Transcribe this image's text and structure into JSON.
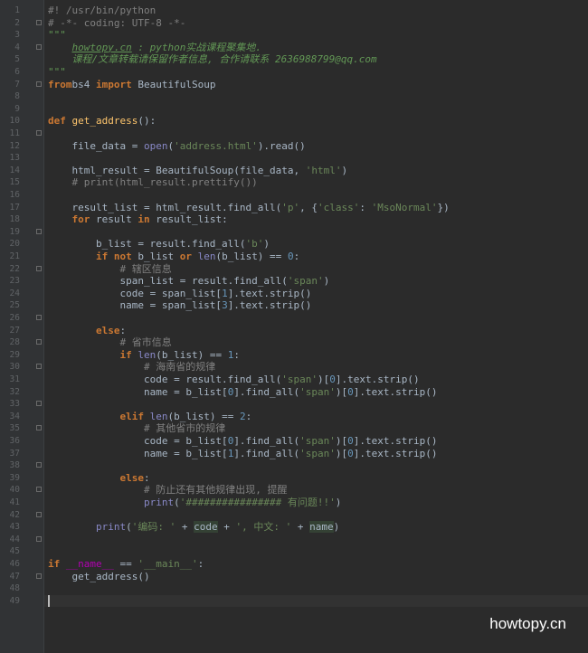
{
  "editor": {
    "lines": [
      {
        "n": "1",
        "segs": [
          [
            "cmt",
            "#! /usr/bin/python"
          ]
        ]
      },
      {
        "n": "2",
        "segs": [
          [
            "cmt",
            "# -*- coding: UTF-8 -*-"
          ]
        ]
      },
      {
        "n": "3",
        "segs": [
          [
            "doc",
            "\"\"\""
          ]
        ]
      },
      {
        "n": "4",
        "segs": [
          [
            "doc",
            "    "
          ],
          [
            "link",
            "howtopy.cn"
          ],
          [
            "doc",
            " : python实战课程聚集地."
          ]
        ]
      },
      {
        "n": "5",
        "segs": [
          [
            "doc",
            "    课程/文章转载请保留作者信息, 合作请联系 2636988799@qq.com"
          ]
        ]
      },
      {
        "n": "6",
        "segs": [
          [
            "doc",
            "\"\"\""
          ]
        ]
      },
      {
        "n": "7",
        "segs": [
          [
            "kw",
            "from"
          ],
          [
            "",
            "bs4 "
          ],
          [
            "kw",
            "import"
          ],
          [
            "",
            " BeautifulSoup"
          ]
        ]
      },
      {
        "n": "8",
        "segs": []
      },
      {
        "n": "9",
        "segs": []
      },
      {
        "n": "10",
        "segs": [
          [
            "kw",
            "def "
          ],
          [
            "fn",
            "get_address"
          ],
          [
            "",
            "():"
          ]
        ]
      },
      {
        "n": "11",
        "segs": []
      },
      {
        "n": "12",
        "segs": [
          [
            "",
            "    file_data = "
          ],
          [
            "bi",
            "open"
          ],
          [
            "",
            "("
          ],
          [
            "str",
            "'address.html'"
          ],
          [
            "",
            ").read()"
          ]
        ]
      },
      {
        "n": "13",
        "segs": []
      },
      {
        "n": "14",
        "segs": [
          [
            "",
            "    html_result = BeautifulSoup(file_data, "
          ],
          [
            "str",
            "'html'"
          ],
          [
            "",
            ")"
          ]
        ]
      },
      {
        "n": "15",
        "segs": [
          [
            "cmt",
            "    # print(html_result.prettify())"
          ]
        ]
      },
      {
        "n": "16",
        "segs": []
      },
      {
        "n": "17",
        "segs": [
          [
            "",
            "    result_list = html_result.find_all("
          ],
          [
            "str",
            "'p'"
          ],
          [
            "",
            ", {"
          ],
          [
            "str",
            "'class'"
          ],
          [
            "",
            ": "
          ],
          [
            "str",
            "'MsoNormal'"
          ],
          [
            "",
            "})"
          ]
        ]
      },
      {
        "n": "18",
        "segs": [
          [
            "kw",
            "    for "
          ],
          [
            "",
            "result "
          ],
          [
            "kw",
            "in "
          ],
          [
            "",
            "result_list:"
          ]
        ]
      },
      {
        "n": "19",
        "segs": []
      },
      {
        "n": "20",
        "segs": [
          [
            "",
            "        b_list = result.find_all("
          ],
          [
            "str",
            "'b'"
          ],
          [
            "",
            ")"
          ]
        ]
      },
      {
        "n": "21",
        "segs": [
          [
            "kw",
            "        if not "
          ],
          [
            "",
            "b_list "
          ],
          [
            "kw",
            "or "
          ],
          [
            "bi",
            "len"
          ],
          [
            "",
            "(b_list) == "
          ],
          [
            "num",
            "0"
          ],
          [
            "",
            ":"
          ]
        ]
      },
      {
        "n": "22",
        "segs": [
          [
            "cmt",
            "            # 辖区信息"
          ]
        ]
      },
      {
        "n": "23",
        "segs": [
          [
            "",
            "            span_list = result.find_all("
          ],
          [
            "str",
            "'span'"
          ],
          [
            "",
            ")"
          ]
        ]
      },
      {
        "n": "24",
        "segs": [
          [
            "",
            "            code = span_list["
          ],
          [
            "num",
            "1"
          ],
          [
            "",
            "].text.strip()"
          ]
        ]
      },
      {
        "n": "25",
        "segs": [
          [
            "",
            "            name = span_list["
          ],
          [
            "num",
            "3"
          ],
          [
            "",
            "].text.strip()"
          ]
        ]
      },
      {
        "n": "26",
        "segs": []
      },
      {
        "n": "27",
        "segs": [
          [
            "kw",
            "        else"
          ],
          [
            "",
            ":"
          ]
        ]
      },
      {
        "n": "28",
        "segs": [
          [
            "cmt",
            "            # 省市信息"
          ]
        ]
      },
      {
        "n": "29",
        "segs": [
          [
            "kw",
            "            if "
          ],
          [
            "bi",
            "len"
          ],
          [
            "",
            "(b_list) == "
          ],
          [
            "num",
            "1"
          ],
          [
            "",
            ":"
          ]
        ]
      },
      {
        "n": "30",
        "segs": [
          [
            "cmt",
            "                # 海南省的规律"
          ]
        ]
      },
      {
        "n": "31",
        "segs": [
          [
            "",
            "                code = result.find_all("
          ],
          [
            "str",
            "'span'"
          ],
          [
            "",
            ")["
          ],
          [
            "num",
            "0"
          ],
          [
            "",
            "].text.strip()"
          ]
        ]
      },
      {
        "n": "32",
        "segs": [
          [
            "",
            "                name = b_list["
          ],
          [
            "num",
            "0"
          ],
          [
            "",
            "].find_all("
          ],
          [
            "str",
            "'span'"
          ],
          [
            "",
            ")["
          ],
          [
            "num",
            "0"
          ],
          [
            "",
            "].text.strip()"
          ]
        ]
      },
      {
        "n": "33",
        "segs": []
      },
      {
        "n": "34",
        "segs": [
          [
            "kw",
            "            elif "
          ],
          [
            "bi",
            "len"
          ],
          [
            "",
            "(b_list) == "
          ],
          [
            "num",
            "2"
          ],
          [
            "",
            ":"
          ]
        ]
      },
      {
        "n": "35",
        "segs": [
          [
            "cmt",
            "                # 其他省市的规律"
          ]
        ]
      },
      {
        "n": "36",
        "segs": [
          [
            "",
            "                code = b_list["
          ],
          [
            "num",
            "0"
          ],
          [
            "",
            "].find_all("
          ],
          [
            "str",
            "'span'"
          ],
          [
            "",
            ")["
          ],
          [
            "num",
            "0"
          ],
          [
            "",
            "].text.strip()"
          ]
        ]
      },
      {
        "n": "37",
        "segs": [
          [
            "",
            "                name = b_list["
          ],
          [
            "num",
            "1"
          ],
          [
            "",
            "].find_all("
          ],
          [
            "str",
            "'span'"
          ],
          [
            "",
            ")["
          ],
          [
            "num",
            "0"
          ],
          [
            "",
            "].text.strip()"
          ]
        ]
      },
      {
        "n": "38",
        "segs": []
      },
      {
        "n": "39",
        "segs": [
          [
            "kw",
            "            else"
          ],
          [
            "",
            ":"
          ]
        ]
      },
      {
        "n": "40",
        "segs": [
          [
            "cmt",
            "                # 防止还有其他规律出现, 提醒"
          ]
        ]
      },
      {
        "n": "41",
        "segs": [
          [
            "",
            "                "
          ],
          [
            "bi",
            "print"
          ],
          [
            "",
            "("
          ],
          [
            "str",
            "'################ 有问题!!'"
          ],
          [
            "",
            ")"
          ]
        ]
      },
      {
        "n": "42",
        "segs": []
      },
      {
        "n": "43",
        "segs": [
          [
            "",
            "        "
          ],
          [
            "bi",
            "print"
          ],
          [
            "",
            "("
          ],
          [
            "str",
            "'编码: '"
          ],
          [
            "",
            " + "
          ],
          [
            "hl",
            "code"
          ],
          [
            "",
            " + "
          ],
          [
            "str",
            "', 中文: '"
          ],
          [
            "",
            " + "
          ],
          [
            "hl",
            "name"
          ],
          [
            "",
            ")"
          ]
        ]
      },
      {
        "n": "44",
        "segs": []
      },
      {
        "n": "45",
        "segs": []
      },
      {
        "n": "46",
        "segs": [
          [
            "kw",
            "if "
          ],
          [
            "mg",
            "__name__"
          ],
          [
            "",
            " == "
          ],
          [
            "str",
            "'__main__'"
          ],
          [
            "",
            ":"
          ]
        ]
      },
      {
        "n": "47",
        "segs": [
          [
            "",
            "    get_address()"
          ]
        ]
      },
      {
        "n": "48",
        "segs": []
      },
      {
        "n": "49",
        "segs": []
      }
    ],
    "folds": [
      1,
      3,
      6,
      10,
      18,
      21,
      25,
      27,
      29,
      32,
      34,
      37,
      39,
      41,
      43,
      46
    ]
  },
  "watermark": "howtopy.cn"
}
